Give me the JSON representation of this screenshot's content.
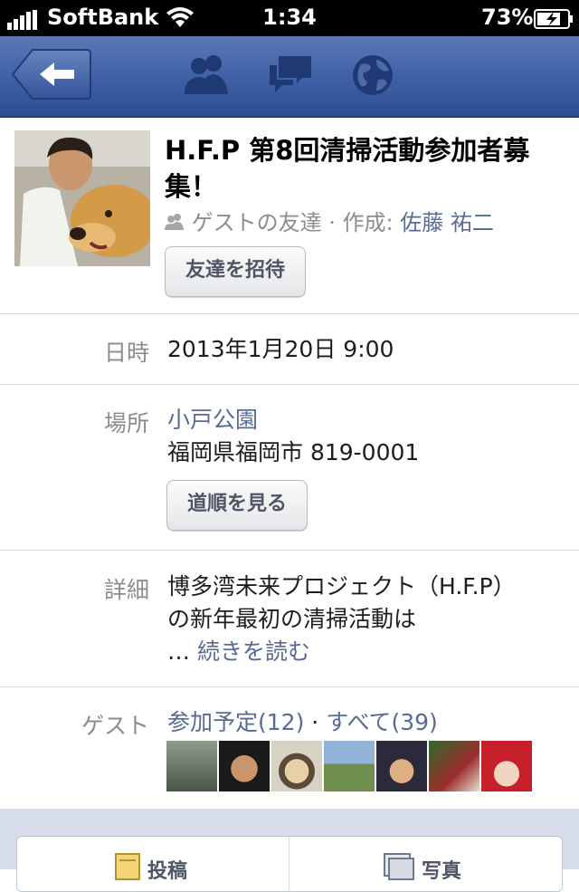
{
  "status_bar": {
    "carrier": "SoftBank",
    "time": "1:34",
    "battery": "73%"
  },
  "nav": {
    "icons": [
      "back-arrow-icon",
      "friends-icon",
      "messages-icon",
      "notifications-globe-icon"
    ]
  },
  "event": {
    "title": "H.F.P 第8回清掃活動参加者募集！",
    "privacy": "ゲストの友達",
    "separator": "·",
    "creator_prefix": "作成:",
    "creator": "佐藤 祐二",
    "invite_button": "友達を招待"
  },
  "details": {
    "datetime_label": "日時",
    "datetime_value": "2013年1月20日 9:00",
    "place_label": "場所",
    "place_name": "小戸公園",
    "place_address": "福岡県福岡市 819-0001",
    "directions_button": "道順を見る",
    "detail_label": "詳細",
    "detail_line1": "博多湾未来プロジェクト（H.F.P）",
    "detail_line2": "の新年最初の清掃活動は",
    "detail_ellipsis": "…",
    "read_more": "続きを読む",
    "guests_label": "ゲスト",
    "going": "参加予定(12)",
    "guests_sep": "·",
    "all": "すべて(39)"
  },
  "actions": {
    "post": "投稿",
    "photo": "写真"
  },
  "colors": {
    "nav_blue": "#3e5fa5",
    "link": "#576b95",
    "muted": "#8c8c8c"
  }
}
